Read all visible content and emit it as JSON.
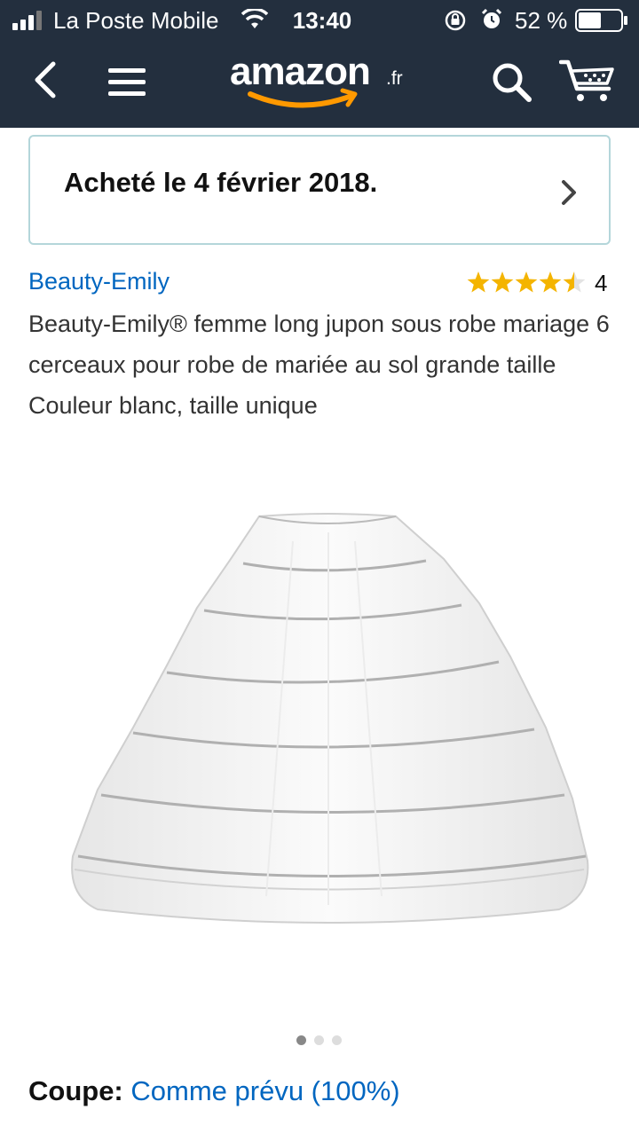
{
  "status_bar": {
    "carrier": "La Poste Mobile",
    "time": "13:40",
    "battery": "52 %",
    "icons": [
      "signal-icon",
      "wifi-icon",
      "orientation-lock-icon",
      "alarm-icon",
      "battery-icon"
    ]
  },
  "nav": {
    "logo_word": "amazon",
    "logo_tld": ".fr",
    "icons": [
      "back-icon",
      "menu-icon",
      "search-icon",
      "cart-icon"
    ]
  },
  "purchase": {
    "text": "Acheté le 4 février 2018.",
    "icon": "chevron-right-icon"
  },
  "product": {
    "brand": "Beauty-Emily",
    "rating": 4.5,
    "review_count": "4",
    "title": "Beauty-Emily® femme long jupon sous robe mariage 6 cerceaux pour robe de mariée au sol grande taille Couleur blanc, taille unique",
    "image_count": 3,
    "current_image": 1
  },
  "fit": {
    "label": "Coupe:",
    "value": "Comme prévu (100%)"
  },
  "colors": {
    "header_bg": "#232f3e",
    "link": "#0066c0",
    "star": "#f4b400",
    "box_border": "#b4d6da",
    "smile": "#ff9900"
  }
}
